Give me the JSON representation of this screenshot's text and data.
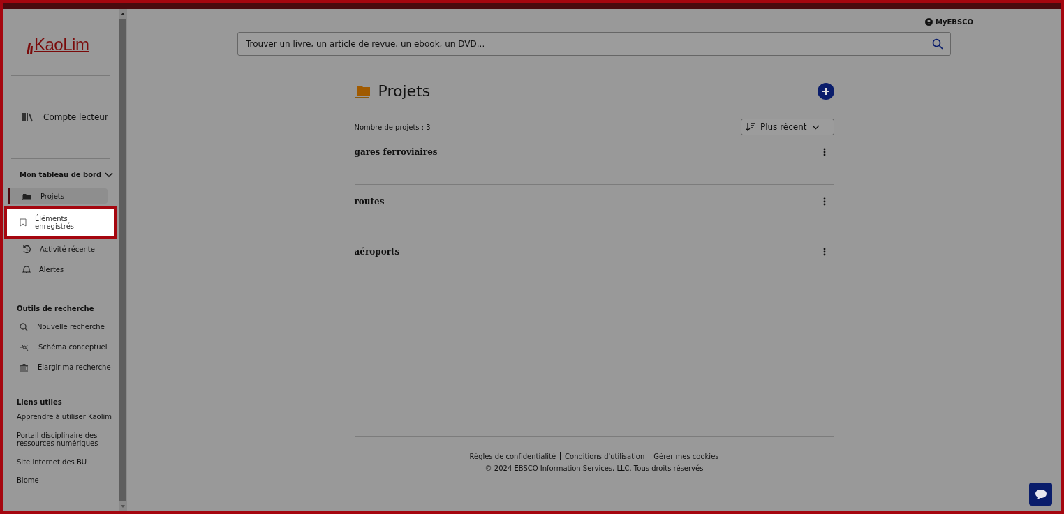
{
  "logo": {
    "text": "KaoLim"
  },
  "account_link": {
    "label": "Compte lecteur"
  },
  "dashboard": {
    "title": "Mon tableau de bord",
    "expanded": true,
    "items": [
      {
        "label": "Projets",
        "kind": "folder",
        "selected": true,
        "highlighted": false
      },
      {
        "label": "Éléments enregistrés",
        "kind": "bookmark",
        "selected": false,
        "highlighted": true
      },
      {
        "label": "Activité récente",
        "kind": "history",
        "selected": false,
        "highlighted": false
      },
      {
        "label": "Alertes",
        "kind": "bell",
        "selected": false,
        "highlighted": false
      }
    ]
  },
  "research_tools": {
    "title": "Outils de recherche",
    "items": [
      {
        "label": "Nouvelle recherche",
        "kind": "search"
      },
      {
        "label": "Schéma conceptuel",
        "kind": "network"
      },
      {
        "label": "Elargir ma recherche",
        "kind": "bank"
      }
    ]
  },
  "useful_links": {
    "title": "Liens utiles",
    "items": [
      "Apprendre à utiliser Kaolim",
      "Portail disciplinaire des ressources numériques",
      "Site internet des BU",
      "Biome"
    ]
  },
  "user_menu": {
    "label": "MyEBSCO"
  },
  "search": {
    "placeholder": "Trouver un livre, un article de revue, un ebook, un DVD..."
  },
  "projects": {
    "title": "Projets",
    "count": "Nombre de projets : 3",
    "sort": "Plus récent",
    "items": [
      {
        "name": "gares ferroviaires"
      },
      {
        "name": "routes"
      },
      {
        "name": "aéroports"
      }
    ]
  },
  "footer": {
    "links": [
      "Règles de confidentialité",
      "Conditions d'utilisation",
      "Gérer mes cookies"
    ],
    "copyright": "© 2024 EBSCO Information Services, LLC. Tous droits réservés"
  }
}
